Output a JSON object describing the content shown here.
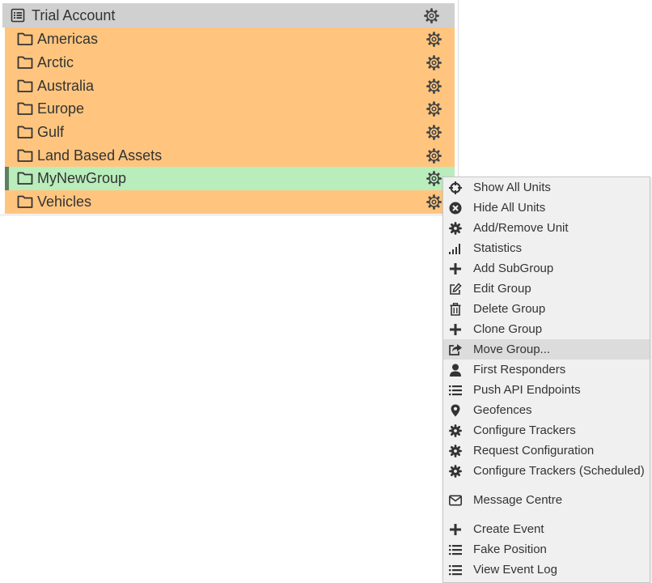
{
  "tree": {
    "root": {
      "label": "Trial Account",
      "icon": "list-icon"
    },
    "groups": [
      {
        "label": "Americas",
        "icon": "folder-icon",
        "state": "normal"
      },
      {
        "label": "Arctic",
        "icon": "folder-icon",
        "state": "normal"
      },
      {
        "label": "Australia",
        "icon": "folder-icon",
        "state": "normal"
      },
      {
        "label": "Europe",
        "icon": "folder-icon",
        "state": "normal"
      },
      {
        "label": "Gulf",
        "icon": "folder-icon",
        "state": "normal"
      },
      {
        "label": "Land Based Assets",
        "icon": "folder-icon",
        "state": "normal"
      },
      {
        "label": "MyNewGroup",
        "icon": "folder-icon",
        "state": "selected"
      },
      {
        "label": "Vehicles",
        "icon": "folder-icon",
        "state": "normal"
      }
    ],
    "colors": {
      "group_bg": "#ffc57f",
      "selected_bg": "#b9edbb",
      "header_bg": "#d0d0d0"
    }
  },
  "context_menu": {
    "items": [
      {
        "label": "Show All Units",
        "icon": "crosshairs-icon"
      },
      {
        "label": "Hide All Units",
        "icon": "times-circle-icon"
      },
      {
        "label": "Add/Remove Unit",
        "icon": "cog-icon"
      },
      {
        "label": "Statistics",
        "icon": "signal-bars-icon"
      },
      {
        "label": "Add SubGroup",
        "icon": "plus-icon"
      },
      {
        "label": "Edit Group",
        "icon": "edit-icon"
      },
      {
        "label": "Delete Group",
        "icon": "trash-icon"
      },
      {
        "label": "Clone Group",
        "icon": "plus-icon"
      },
      {
        "label": "Move Group...",
        "icon": "share-icon",
        "state": "hover"
      },
      {
        "label": "First Responders",
        "icon": "user-icon"
      },
      {
        "label": "Push API Endpoints",
        "icon": "list-icon"
      },
      {
        "label": "Geofences",
        "icon": "map-marker-icon"
      },
      {
        "label": "Configure Trackers",
        "icon": "cog-icon"
      },
      {
        "label": "Request Configuration",
        "icon": "cog-icon"
      },
      {
        "label": "Configure Trackers (Scheduled)",
        "icon": "cog-icon"
      },
      {
        "label": "Message Centre",
        "icon": "envelope-icon"
      },
      {
        "label": "Create Event",
        "icon": "plus-icon"
      },
      {
        "label": "Fake Position",
        "icon": "list-icon"
      },
      {
        "label": "View Event Log",
        "icon": "list-icon"
      }
    ],
    "colors": {
      "bg": "#f0f0f0",
      "hover_bg": "#dcdcdc"
    }
  }
}
